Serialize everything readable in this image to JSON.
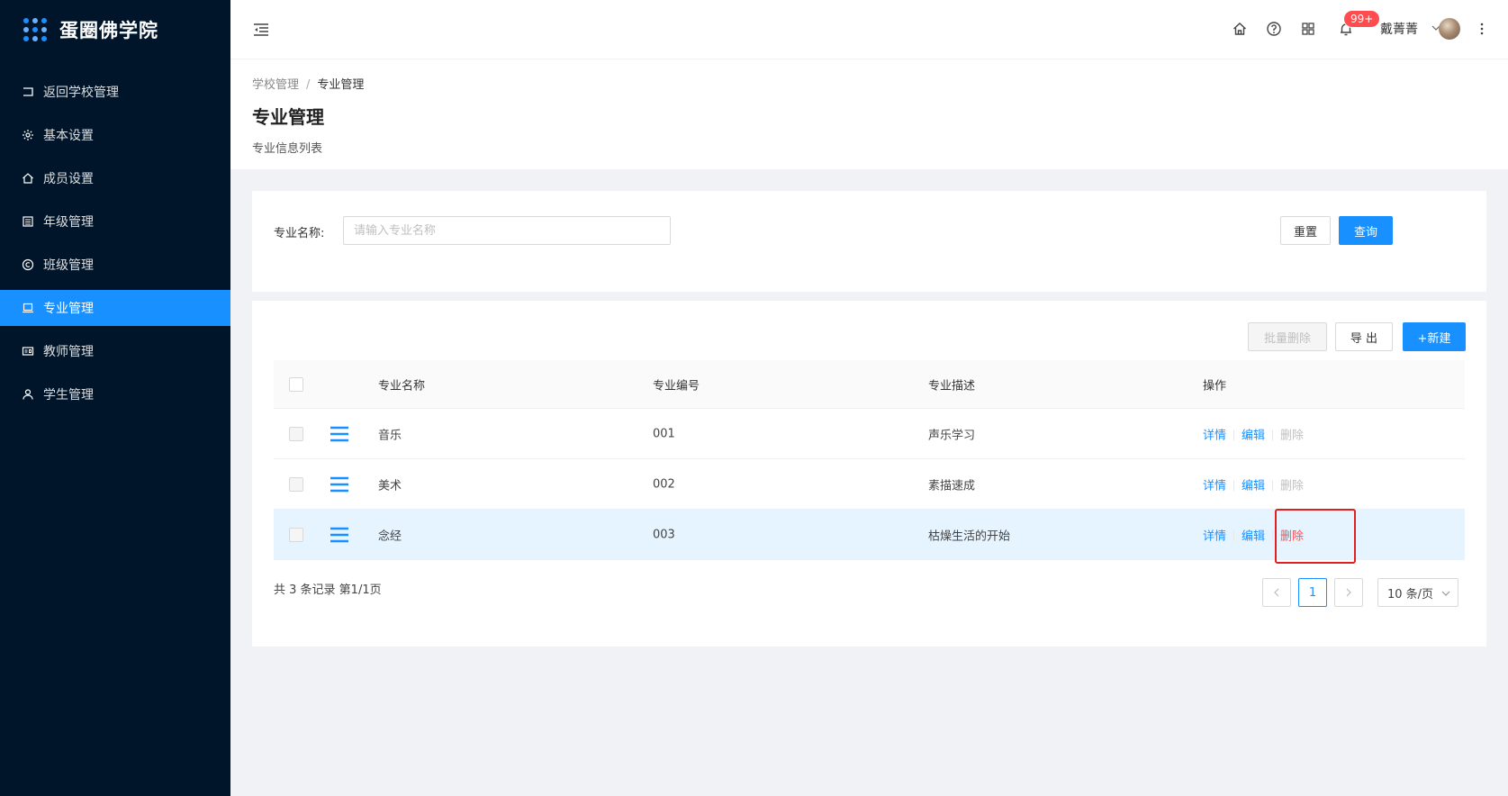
{
  "app": {
    "title": "蛋圈佛学院"
  },
  "sidebar": {
    "items": [
      {
        "label": "返回学校管理",
        "icon": "return-icon"
      },
      {
        "label": "基本设置",
        "icon": "gear-icon"
      },
      {
        "label": "成员设置",
        "icon": "home-icon"
      },
      {
        "label": "年级管理",
        "icon": "calendar-icon"
      },
      {
        "label": "班级管理",
        "icon": "copyright-icon"
      },
      {
        "label": "专业管理",
        "icon": "laptop-icon",
        "active": true
      },
      {
        "label": "教师管理",
        "icon": "id-card-icon"
      },
      {
        "label": "学生管理",
        "icon": "user-icon"
      }
    ]
  },
  "header": {
    "badge": "99+",
    "username": "戴菁菁"
  },
  "page": {
    "breadcrumb": [
      "学校管理",
      "专业管理"
    ],
    "title": "专业管理",
    "subtitle": "专业信息列表"
  },
  "search": {
    "label": "专业名称:",
    "placeholder": "请输入专业名称",
    "reset": "重置",
    "query": "查询"
  },
  "toolbar": {
    "batch_delete": "批量删除",
    "export": "导 出",
    "create": "+新建"
  },
  "table": {
    "columns": [
      "专业名称",
      "专业编号",
      "专业描述",
      "操作"
    ],
    "rows": [
      {
        "name": "音乐",
        "code": "001",
        "desc": "声乐学习"
      },
      {
        "name": "美术",
        "code": "002",
        "desc": "素描速成"
      },
      {
        "name": "念经",
        "code": "003",
        "desc": "枯燥生活的开始"
      }
    ],
    "actions": {
      "detail": "详情",
      "edit": "编辑",
      "delete": "删除"
    }
  },
  "pagination": {
    "summary": "共 3 条记录 第1/1页",
    "current": "1",
    "page_size": "10 条/页"
  },
  "colors": {
    "primary": "#1890ff",
    "sidebar": "#001529",
    "danger": "#ff4d4f",
    "highlight": "#e6f4ff"
  }
}
